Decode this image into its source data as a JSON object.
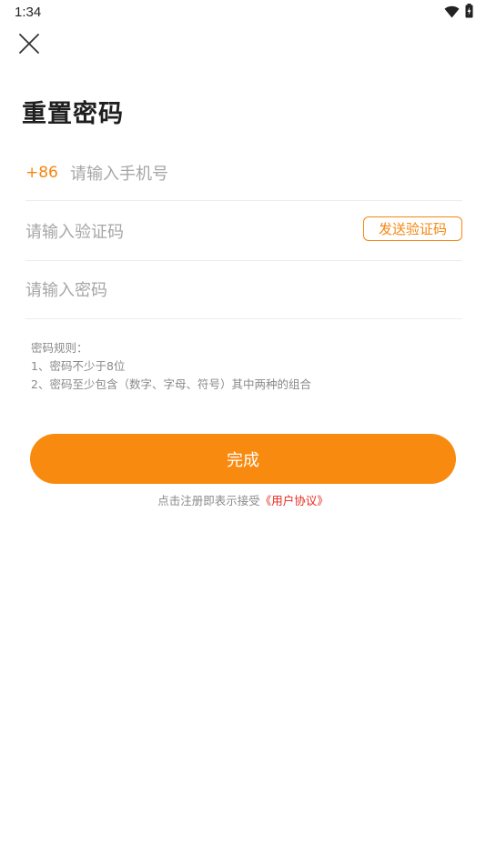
{
  "status_bar": {
    "time": "1:34",
    "icons": [
      "wifi-icon",
      "battery-charging-icon"
    ]
  },
  "header": {
    "close_icon": "close-icon",
    "title": "重置密码"
  },
  "form": {
    "phone": {
      "country_code": "+86",
      "placeholder": "请输入手机号",
      "value": ""
    },
    "code": {
      "placeholder": "请输入验证码",
      "value": "",
      "send_button_label": "发送验证码"
    },
    "password": {
      "placeholder": "请输入密码",
      "value": ""
    }
  },
  "rules": {
    "heading": "密码规则：",
    "items": [
      "1、密码不少于8位",
      "2、密码至少包含（数字、字母、符号）其中两种的组合"
    ]
  },
  "submit": {
    "label": "完成"
  },
  "agreement": {
    "prefix": "点击注册即表示接受",
    "link": "《用户协议》"
  },
  "colors": {
    "accent": "#f98a10",
    "link": "#e8281e",
    "placeholder": "#a6a6a6",
    "divider": "#ececec"
  }
}
